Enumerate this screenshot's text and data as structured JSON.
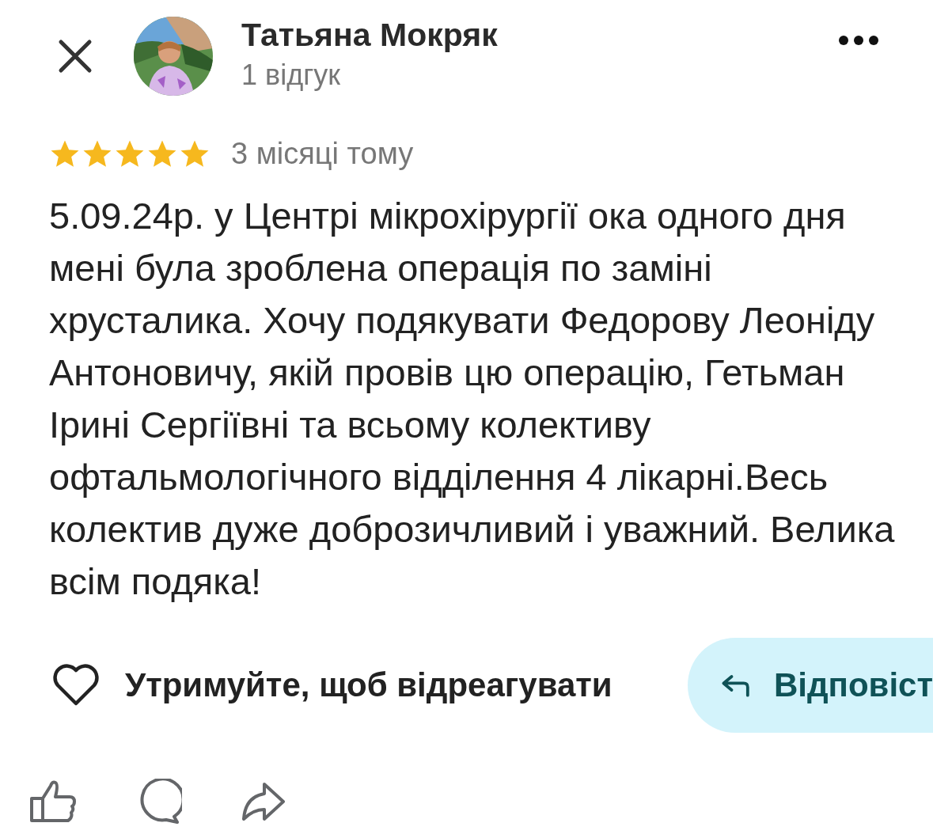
{
  "header": {
    "name": "Татьяна Мокряк",
    "subtitle": "1 відгук"
  },
  "review": {
    "stars": 5,
    "time": "3 місяці тому",
    "text": "5.09.24р. у Центрі мікрохірургії ока одного дня мені була зроблена операція по заміні хрусталика. Хочу подякувати Федорову Леоніду Антоновичу, якій провів цю операцію, Гетьман Ірині Сергіївні та всьому колективу офтальмологічного відділення 4 лікарні.Весь колектив дуже доброзичливий і уважний. Велика всім подяка!"
  },
  "react_hint": "Утримуйте, щоб відреагувати",
  "reply_button": "Відповіст"
}
